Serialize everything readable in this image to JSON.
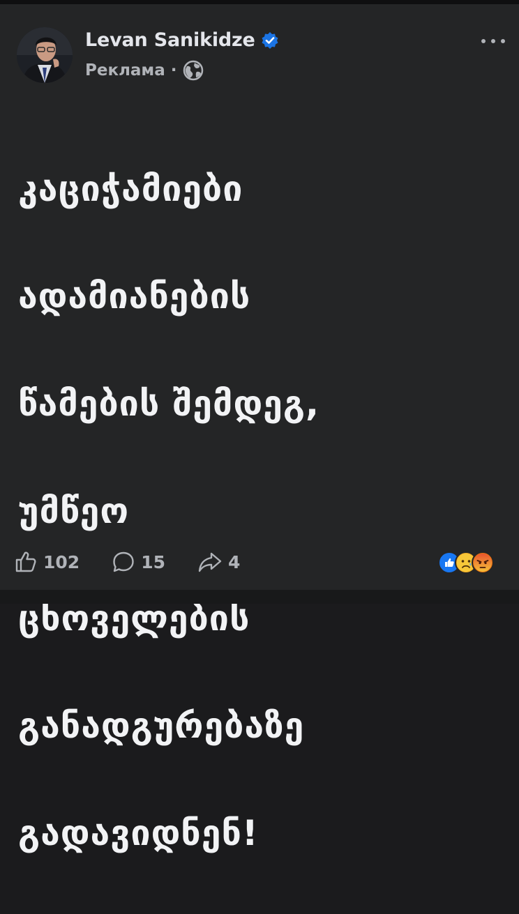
{
  "post": {
    "author_name": "Levan Sanikidze",
    "sponsored_label": "Реклама",
    "separator": "·",
    "text_lines": [
      "კაციჭამიები",
      "ადამიანების",
      "წამების შემდეგ,",
      "უმწეო",
      "ცხოველების",
      "განადგურებაზე",
      "გადავიდნენ!"
    ]
  },
  "icons": {
    "verified": "verified-badge-icon",
    "audience": "globe-icon",
    "menu": "more-horizontal-icon",
    "like": "thumbs-up-icon",
    "comment": "comment-bubble-icon",
    "share": "share-arrow-icon",
    "reactions": [
      "like-reaction-icon",
      "sad-reaction-icon",
      "angry-reaction-icon"
    ]
  },
  "stats": {
    "likes": "102",
    "comments": "15",
    "shares": "4"
  },
  "colors": {
    "background": "#242526",
    "text": "#e4e6eb",
    "secondary_text": "#b0b3b8",
    "verified_blue": "#1b74e4",
    "like_blue": "#1877f2",
    "sad_yellow": "#f7b125",
    "angry_red": "#e9710f"
  }
}
